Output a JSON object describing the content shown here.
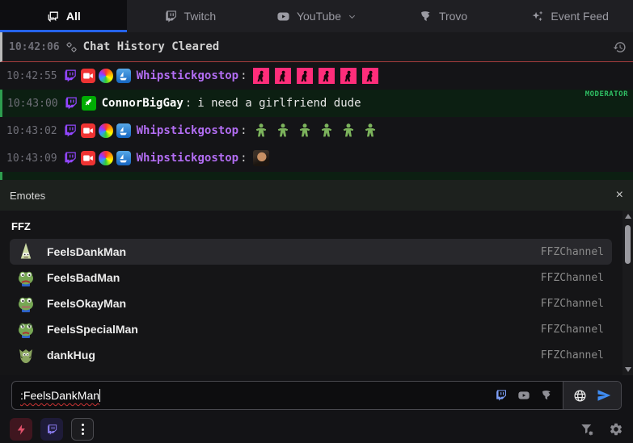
{
  "tab_bar": {
    "tabs": [
      {
        "label": "All",
        "active": true
      },
      {
        "label": "Twitch",
        "active": false
      },
      {
        "label": "YouTube",
        "active": false,
        "has_dropdown": true
      },
      {
        "label": "Trovo",
        "active": false
      },
      {
        "label": "Event Feed",
        "active": false
      }
    ]
  },
  "chat": {
    "messages": [
      {
        "time": "10:42:06",
        "type": "system",
        "text": "Chat History Cleared"
      },
      {
        "time": "10:42:55",
        "type": "user",
        "username": "Whipstickgostop",
        "separator": ":",
        "emote": "pink-dancer",
        "emote_count": 6
      },
      {
        "time": "10:43:00",
        "type": "user",
        "username": "ConnorBigGay",
        "separator": ":",
        "text": "i need a girlfriend dude",
        "role_badge": "MODERATOR"
      },
      {
        "time": "10:43:02",
        "type": "user",
        "username": "Whipstickgostop",
        "separator": ":",
        "emote": "green-dancer",
        "emote_count": 6
      },
      {
        "time": "10:43:09",
        "type": "user",
        "username": "Whipstickgostop",
        "separator": ":",
        "emote": "photo-man",
        "emote_count": 1
      }
    ]
  },
  "emote_panel": {
    "title": "Emotes",
    "close_label": "×",
    "sections": [
      {
        "name": "FFZ",
        "emotes": [
          {
            "name": "FeelsDankMan",
            "channel": "FFZChannel",
            "selected": true
          },
          {
            "name": "FeelsBadMan",
            "channel": "FFZChannel",
            "selected": false
          },
          {
            "name": "FeelsOkayMan",
            "channel": "FFZChannel",
            "selected": false
          },
          {
            "name": "FeelsSpecialMan",
            "channel": "FFZChannel",
            "selected": false
          },
          {
            "name": "dankHug",
            "channel": "FFZChannel",
            "selected": false
          }
        ]
      }
    ]
  },
  "composer": {
    "value": ":FeelsDankMan"
  },
  "icons": {
    "all_tab": "chat-bubbles",
    "twitch": "twitch-glyph",
    "youtube": "play-rect",
    "trovo": "trovo-glyph",
    "event_feed": "sparkles",
    "system_row": "unlink",
    "system_row_right": "history-clock",
    "panel_close": "x",
    "composer_right": [
      "twitch",
      "youtube",
      "trovo",
      "globe",
      "send-arrow"
    ],
    "bottom_left": [
      "lightning-bolt",
      "twitch",
      "vertical-ellipsis"
    ],
    "bottom_right": [
      "filter-gear",
      "gear"
    ]
  },
  "colors": {
    "accent_blue": "#2563eb",
    "twitch_purple": "#9146ff",
    "moderator_green": "#2fbe63",
    "username_purple": "#b26df2",
    "system_divider_red": "#a63d3d",
    "emote_pink": "#ff2d7a",
    "pepe_green": "#7cb35c",
    "send_blue": "#3f8cf3"
  }
}
